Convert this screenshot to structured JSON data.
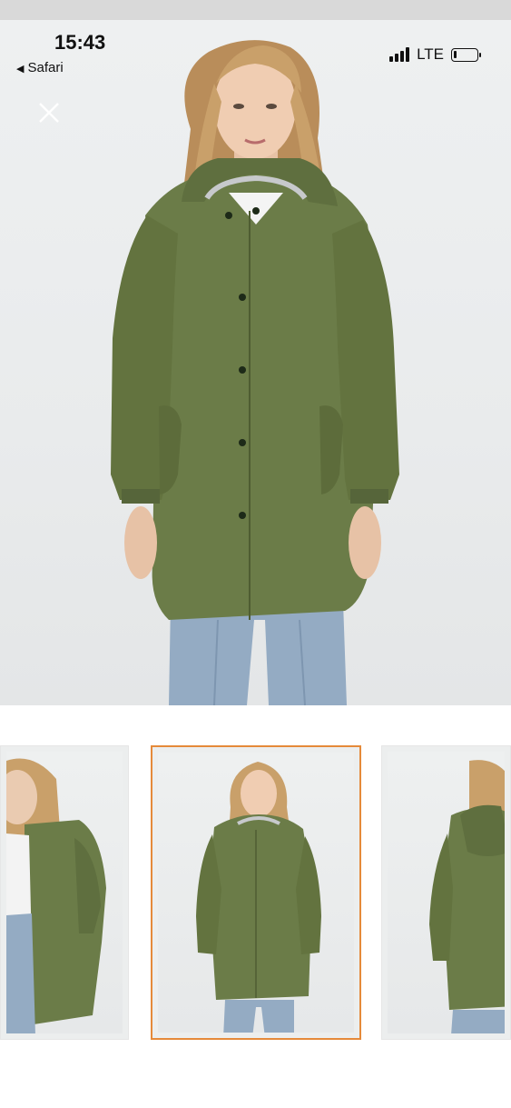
{
  "status_bar": {
    "time": "15:43",
    "back_app": "Safari",
    "network": "LTE",
    "battery_level": 0.15
  },
  "viewer": {
    "close_icon": "close-icon",
    "main_image": "model-in-green-hooded-parka-front-view",
    "coat_color": "#6b7c48",
    "selected_thumbnail_index": 1
  },
  "thumbnails": [
    {
      "view": "side-view"
    },
    {
      "view": "front-view"
    },
    {
      "view": "back-view"
    }
  ],
  "colors": {
    "selected_border": "#e58a3a",
    "coat": "#6b7c48",
    "denim": "#94abc3",
    "hair": "#c9a06a"
  }
}
